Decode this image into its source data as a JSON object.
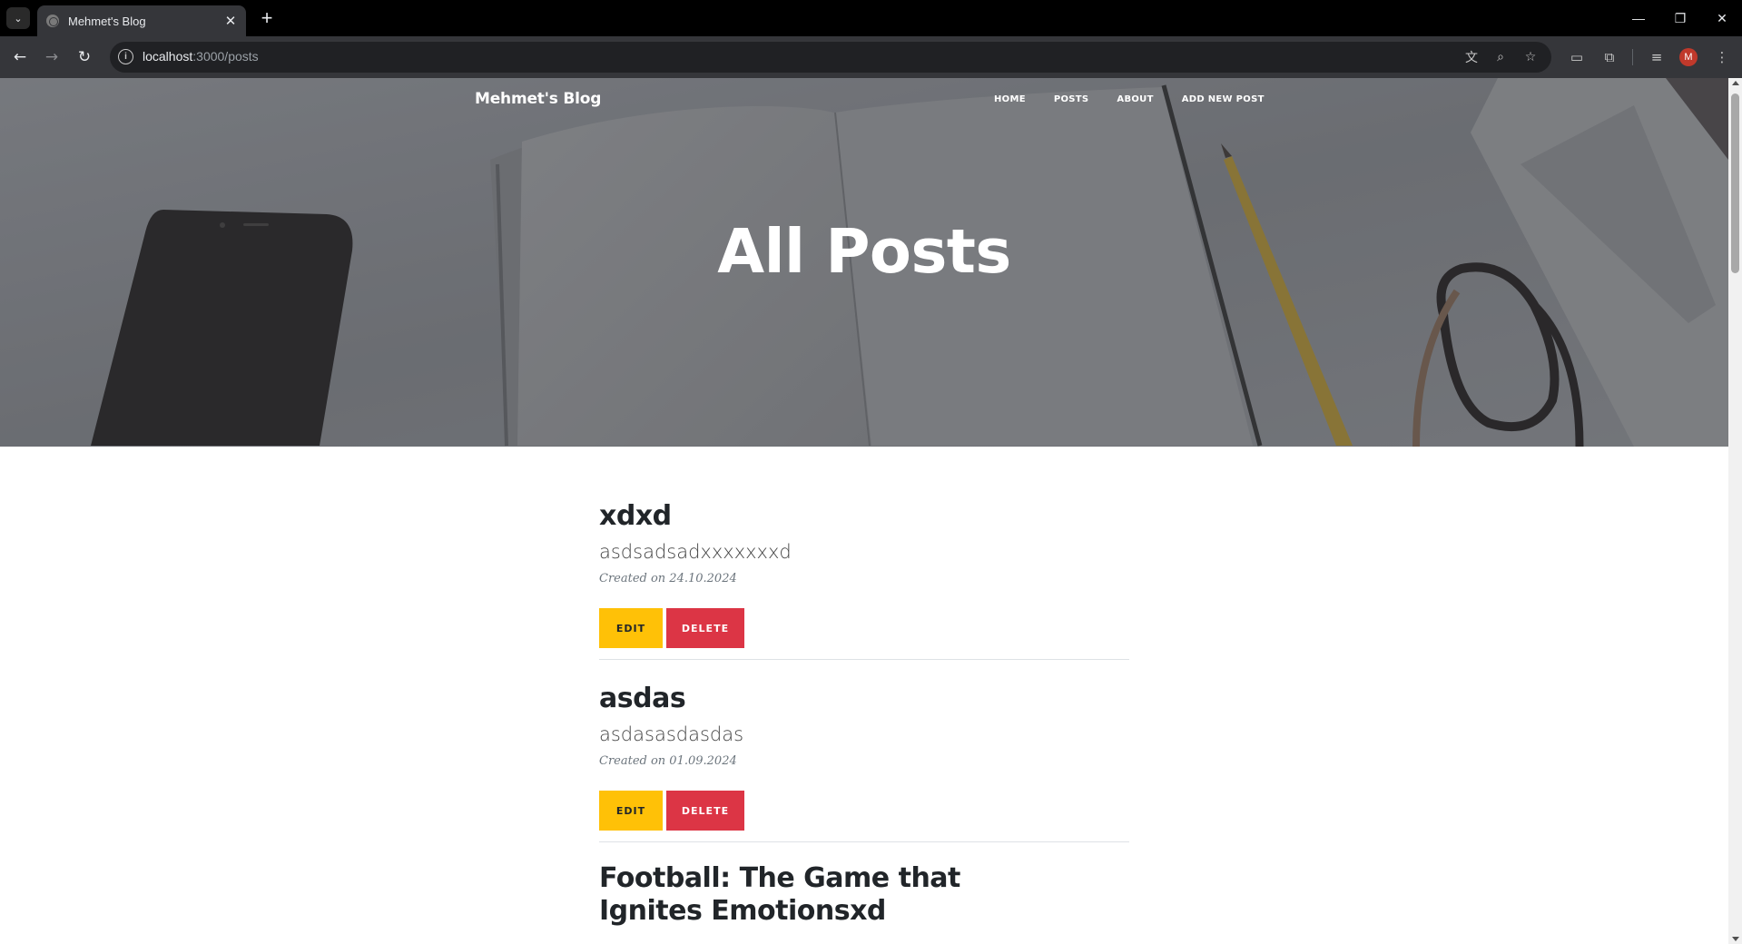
{
  "browser": {
    "tab_title": "Mehmet's Blog",
    "url_host": "localhost",
    "url_path": ":3000/posts",
    "profile_initial": "M"
  },
  "site": {
    "brand": "Mehmet's Blog",
    "nav": [
      "Home",
      "Posts",
      "About",
      "Add New Post"
    ],
    "page_heading": "All Posts"
  },
  "posts": [
    {
      "title": "xdxd",
      "subtitle": "asdsadsadxxxxxxxd",
      "meta": "Created on 24.10.2024",
      "edit_label": "Edit",
      "delete_label": "Delete"
    },
    {
      "title": "asdas",
      "subtitle": "asdasasdasdas",
      "meta": "Created on 01.09.2024",
      "edit_label": "Edit",
      "delete_label": "Delete"
    },
    {
      "title": "Football: The Game that Ignites Emotionsxd"
    }
  ],
  "colors": {
    "edit": "#ffc107",
    "delete": "#dc3545",
    "title": "#212529"
  }
}
